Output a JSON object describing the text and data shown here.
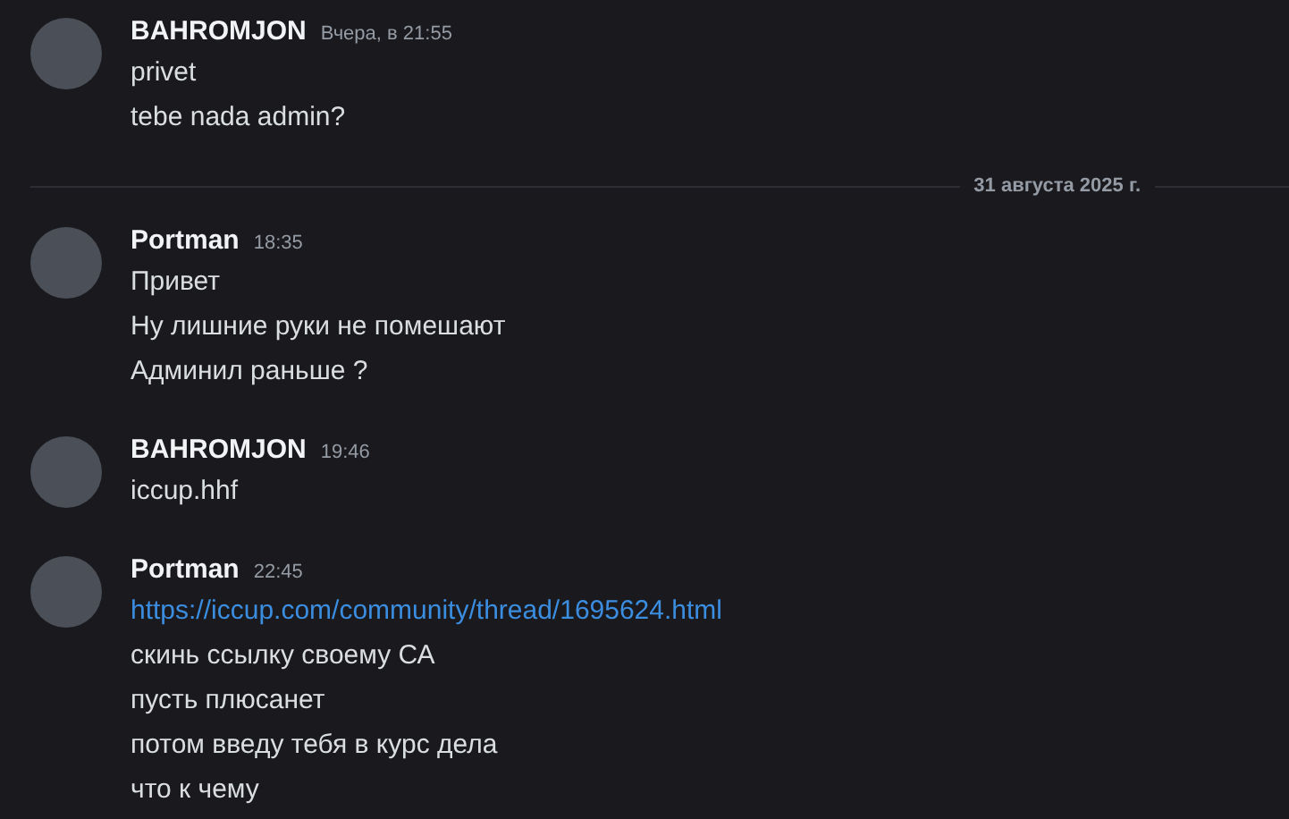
{
  "feed": [
    {
      "kind": "message",
      "author": "BAHROMJON",
      "time": "Вчера, в 21:55",
      "lines": [
        {
          "kind": "text",
          "text": "privet"
        },
        {
          "kind": "text",
          "text": "tebe nada admin?"
        }
      ]
    },
    {
      "kind": "divider",
      "label": "31 августа 2025 г."
    },
    {
      "kind": "message",
      "author": "Portman",
      "time": "18:35",
      "lines": [
        {
          "kind": "text",
          "text": "Привет"
        },
        {
          "kind": "text",
          "text": "Ну лишние руки не помешают"
        },
        {
          "kind": "text",
          "text": "Админил раньше ?"
        }
      ]
    },
    {
      "kind": "message",
      "author": "BAHROMJON",
      "time": "19:46",
      "lines": [
        {
          "kind": "text",
          "text": "iccup.hhf"
        }
      ]
    },
    {
      "kind": "message",
      "author": "Portman",
      "time": "22:45",
      "lines": [
        {
          "kind": "link",
          "text": "https://iccup.com/community/thread/1695624.html"
        },
        {
          "kind": "text",
          "text": "скинь ссылку своему СА"
        },
        {
          "kind": "text",
          "text": "пусть плюсанет"
        },
        {
          "kind": "text",
          "text": "потом введу тебя в курс дела"
        },
        {
          "kind": "text",
          "text": "что к чему"
        }
      ]
    }
  ]
}
